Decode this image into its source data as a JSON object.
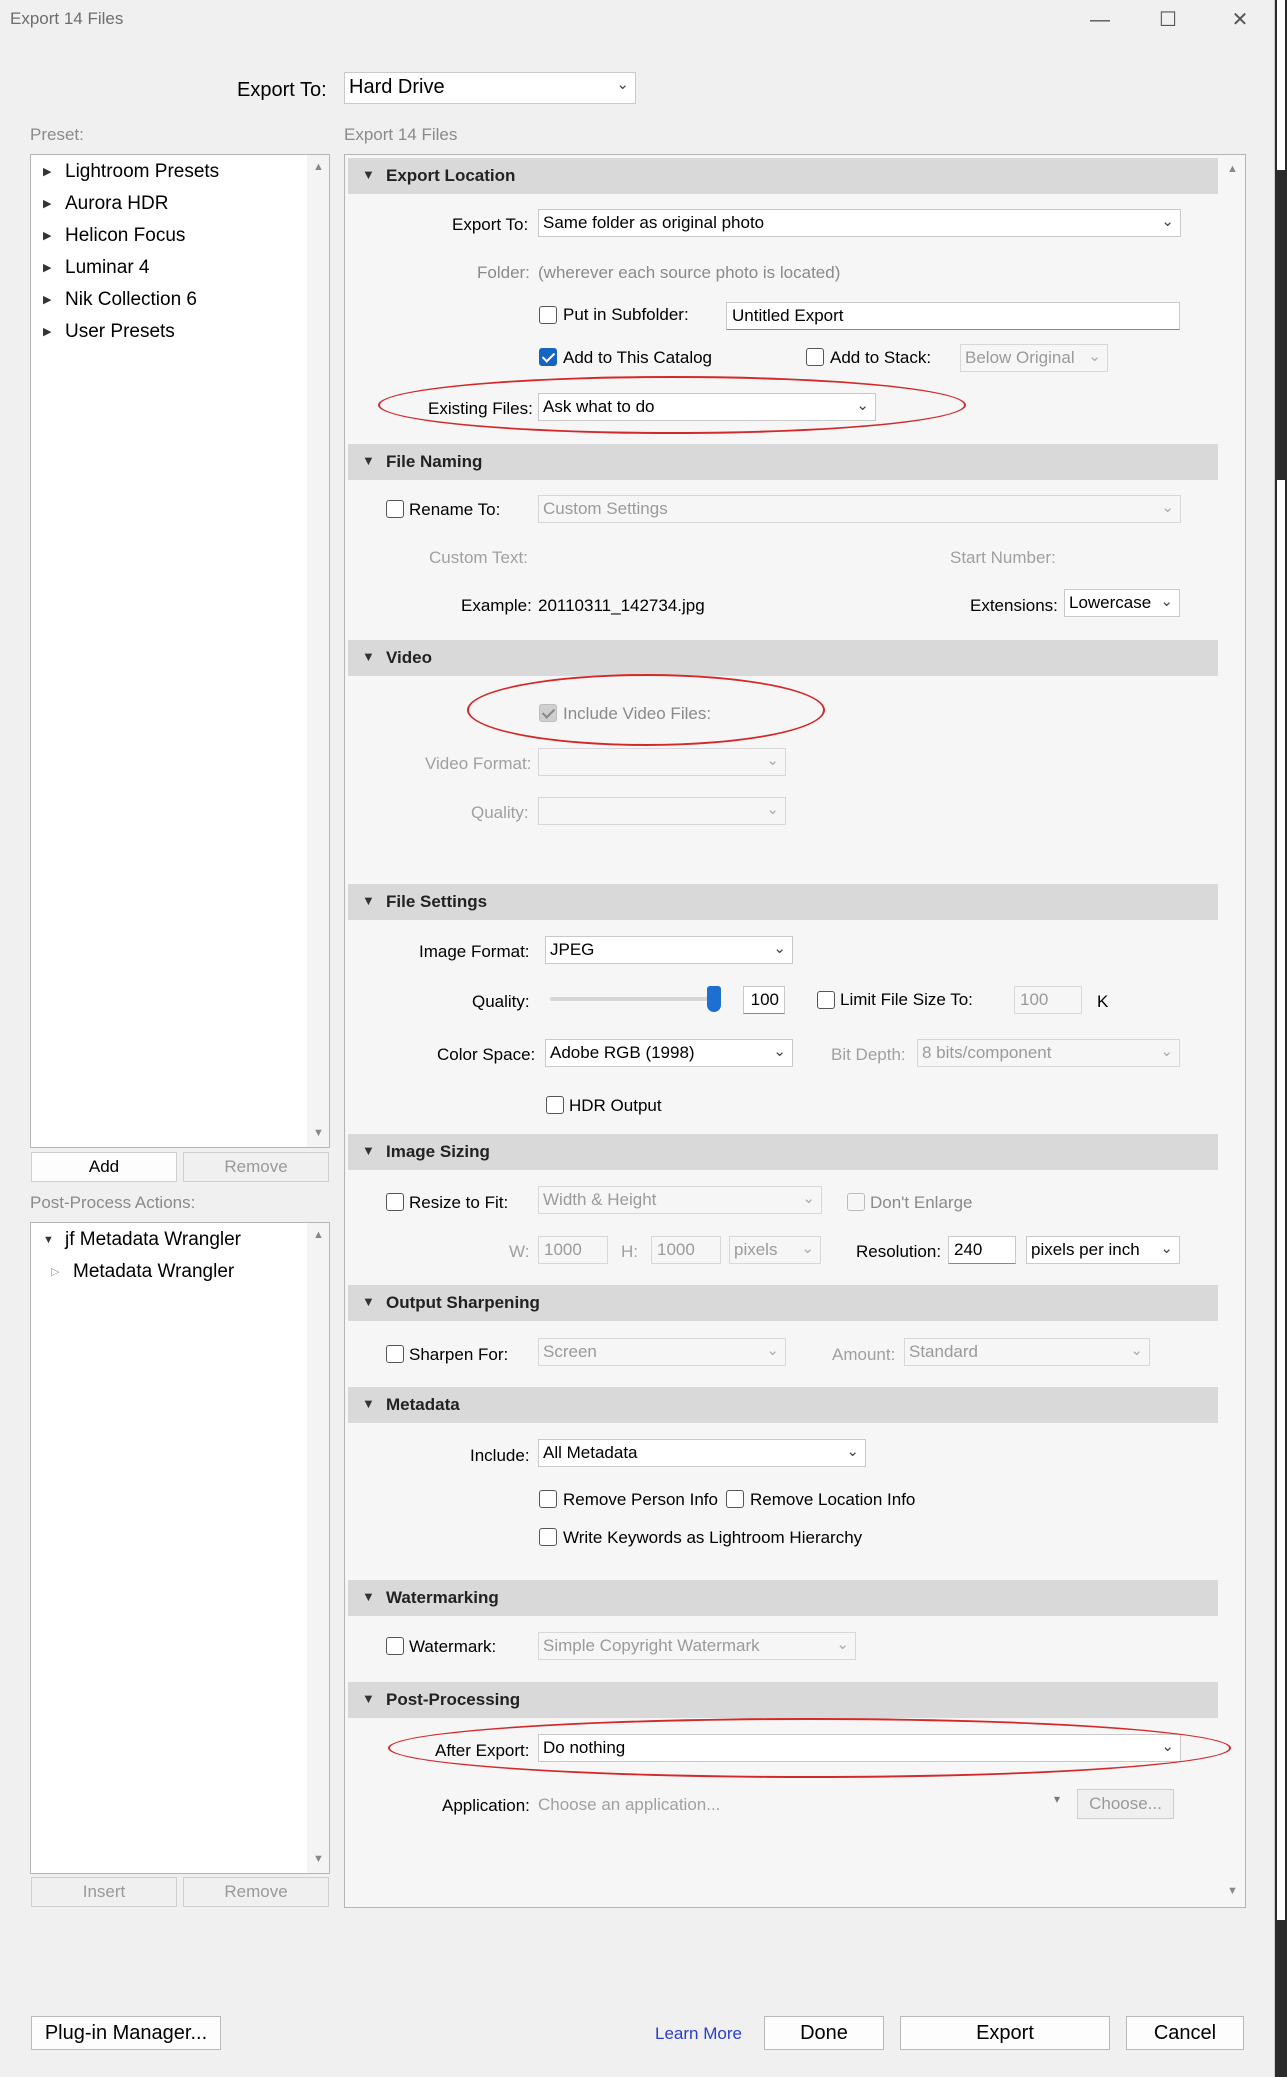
{
  "window": {
    "title": "Export 14 Files"
  },
  "header": {
    "export_to_label": "Export To:",
    "export_to_value": "Hard Drive",
    "export_count": "Export 14 Files"
  },
  "preset": {
    "label": "Preset:",
    "items": [
      "Lightroom Presets",
      "Aurora HDR",
      "Helicon Focus",
      "Luminar 4",
      "Nik Collection 6",
      "User Presets"
    ],
    "add": "Add",
    "remove": "Remove"
  },
  "post_process_actions": {
    "label": "Post-Process Actions:",
    "group": "jf Metadata Wrangler",
    "child": "Metadata Wrangler",
    "insert": "Insert",
    "remove": "Remove"
  },
  "export_location": {
    "title": "Export Location",
    "export_to_label": "Export To:",
    "export_to_value": "Same folder as original photo",
    "folder_label": "Folder:",
    "folder_value": "(wherever each source photo is located)",
    "subfolder_label": "Put in Subfolder:",
    "subfolder_value": "Untitled Export",
    "add_catalog_label": "Add to This Catalog",
    "add_stack_label": "Add to Stack:",
    "add_stack_value": "Below Original",
    "existing_label": "Existing Files:",
    "existing_value": "Ask what to do"
  },
  "file_naming": {
    "title": "File Naming",
    "rename_label": "Rename To:",
    "rename_value": "Custom Settings",
    "custom_text_label": "Custom Text:",
    "start_number_label": "Start Number:",
    "example_label": "Example:",
    "example_value": "20110311_142734.jpg",
    "extensions_label": "Extensions:",
    "extensions_value": "Lowercase"
  },
  "video": {
    "title": "Video",
    "include_label": "Include Video Files:",
    "format_label": "Video Format:",
    "quality_label": "Quality:"
  },
  "file_settings": {
    "title": "File Settings",
    "format_label": "Image Format:",
    "format_value": "JPEG",
    "quality_label": "Quality:",
    "quality_value": "100",
    "quality_fraction": 1.0,
    "limit_label": "Limit File Size To:",
    "limit_value": "100",
    "limit_unit": "K",
    "colorspace_label": "Color Space:",
    "colorspace_value": "Adobe RGB (1998)",
    "bitdepth_label": "Bit Depth:",
    "bitdepth_value": "8 bits/component",
    "hdr_label": "HDR Output"
  },
  "image_sizing": {
    "title": "Image Sizing",
    "resize_label": "Resize to Fit:",
    "resize_value": "Width & Height",
    "dont_enlarge_label": "Don't Enlarge",
    "w_label": "W:",
    "w_value": "1000",
    "h_label": "H:",
    "h_value": "1000",
    "unit_value": "pixels",
    "resolution_label": "Resolution:",
    "resolution_value": "240",
    "resolution_unit": "pixels per inch"
  },
  "output_sharpening": {
    "title": "Output Sharpening",
    "sharpen_label": "Sharpen For:",
    "sharpen_value": "Screen",
    "amount_label": "Amount:",
    "amount_value": "Standard"
  },
  "metadata": {
    "title": "Metadata",
    "include_label": "Include:",
    "include_value": "All Metadata",
    "remove_person": "Remove Person Info",
    "remove_location": "Remove Location Info",
    "write_keywords": "Write Keywords as Lightroom Hierarchy"
  },
  "watermarking": {
    "title": "Watermarking",
    "watermark_label": "Watermark:",
    "watermark_value": "Simple Copyright Watermark"
  },
  "post_processing": {
    "title": "Post-Processing",
    "after_label": "After Export:",
    "after_value": "Do nothing",
    "application_label": "Application:",
    "application_placeholder": "Choose an application...",
    "choose_button": "Choose..."
  },
  "footer": {
    "plugin_manager": "Plug-in Manager...",
    "learn_more": "Learn More",
    "done": "Done",
    "export": "Export",
    "cancel": "Cancel"
  },
  "colors": {
    "accent": "#1565c0",
    "annotation_red": "#d22a2a",
    "link": "#2a3ec9"
  }
}
